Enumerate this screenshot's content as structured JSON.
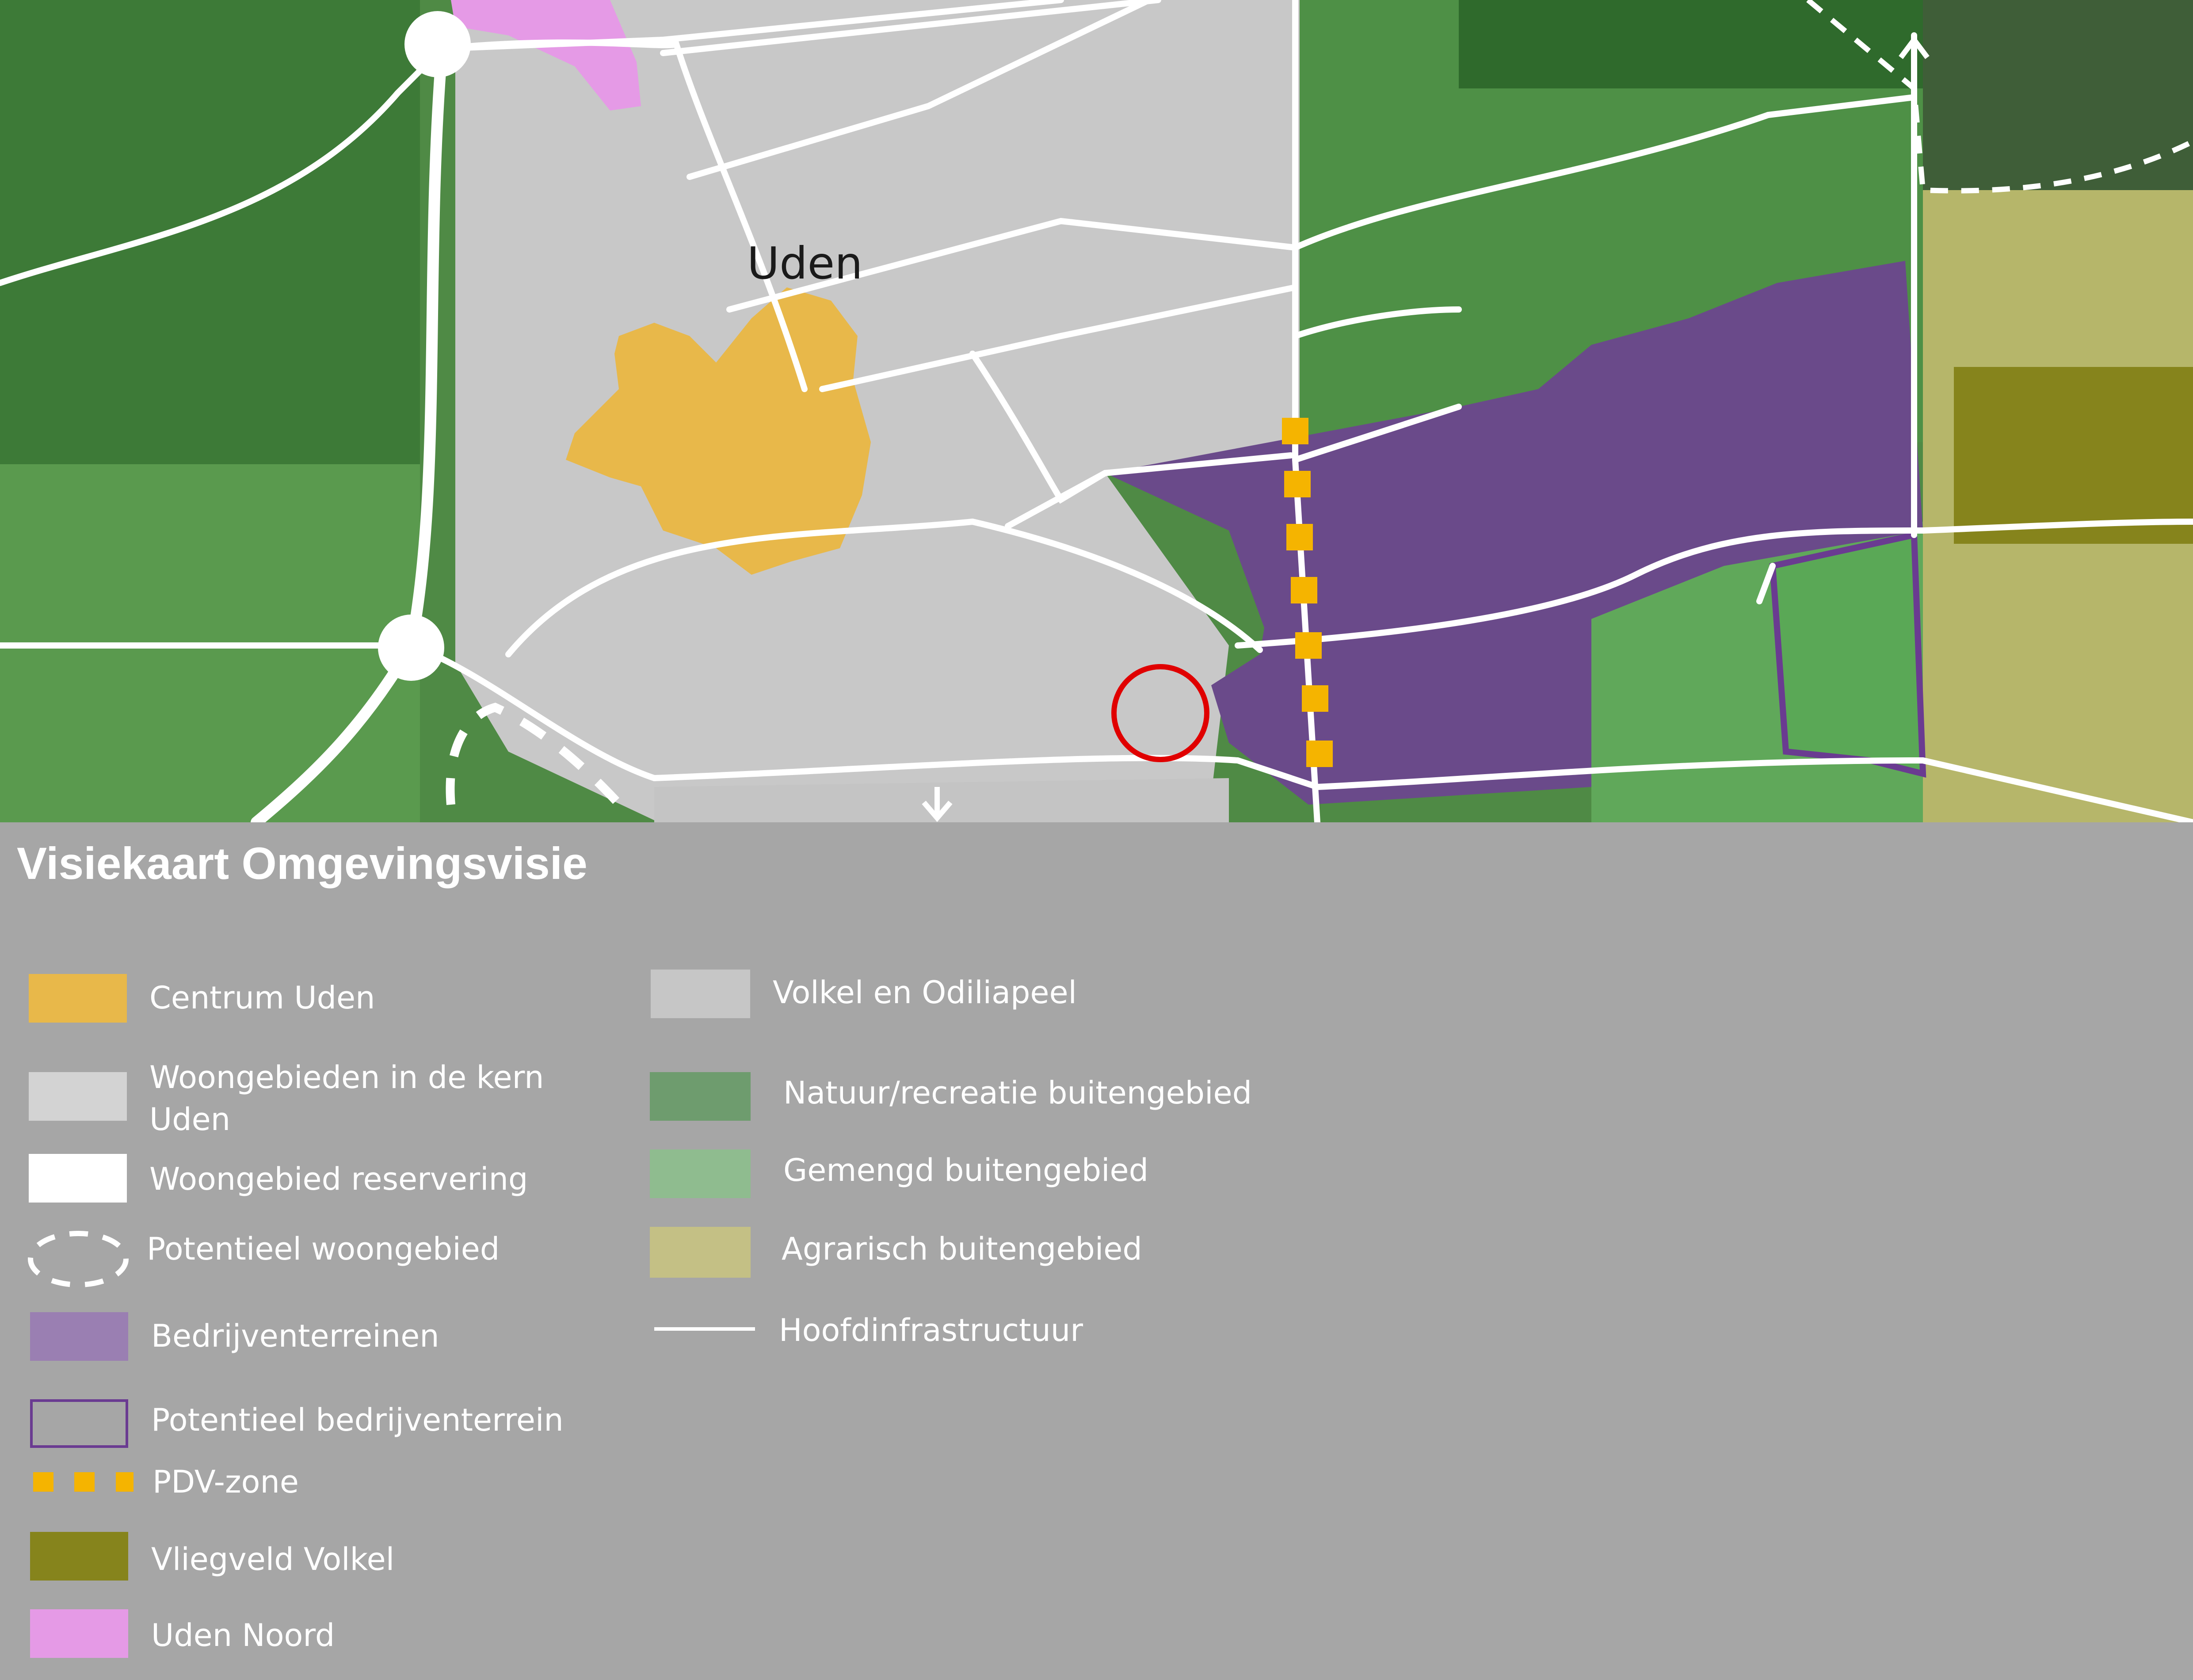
{
  "map": {
    "town_label": "Uden"
  },
  "legend": {
    "title": "Visiekaart Omgevingsvisie",
    "items": [
      {
        "label": "Centrum Uden",
        "color": "#e8b84a"
      },
      {
        "label": "Woongebieden in de kern Uden",
        "color": "#d3d3d3"
      },
      {
        "label": "Woongebied reservering",
        "color": "#ffffff"
      },
      {
        "label": "Potentieel woongebied",
        "color": "#ffffff"
      },
      {
        "label": "Bedrijventerreinen",
        "color": "#9a7fb2"
      },
      {
        "label": "Potentieel bedrijventerrein",
        "color": "#6a3b91"
      },
      {
        "label": "PDV-zone",
        "color": "#f5b400"
      },
      {
        "label": "Vliegveld Volkel",
        "color": "#86841c"
      },
      {
        "label": "Uden Noord",
        "color": "#e59ae6"
      },
      {
        "label": "Volkel en Odiliapeel",
        "color": "#c6c6c6"
      },
      {
        "label": "Natuur/recreatie buitengebied",
        "color": "#6e9c6e"
      },
      {
        "label": "Gemengd buitengebied",
        "color": "#8fbc8f"
      },
      {
        "label": "Agrarisch buitengebied",
        "color": "#c4c085"
      },
      {
        "label": "Hoofdinfrastructuur",
        "color": "#ffffff"
      }
    ]
  }
}
